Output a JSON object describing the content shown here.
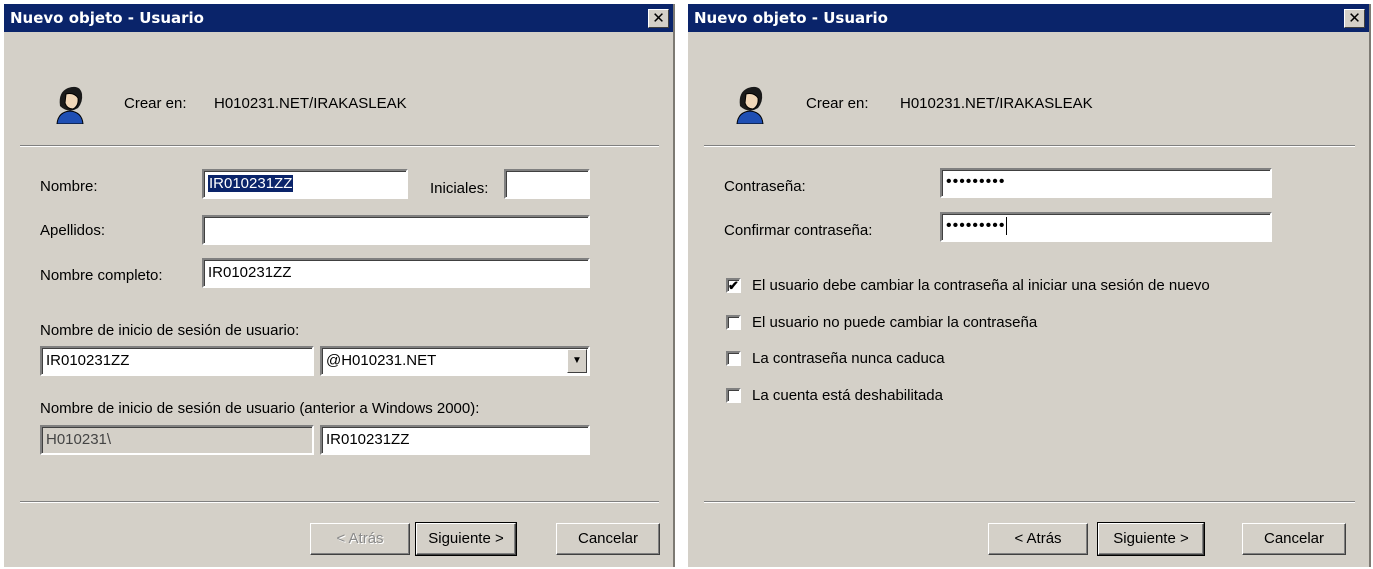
{
  "dialog1": {
    "title": "Nuevo objeto - Usuario",
    "create_in_label": "Crear en:",
    "create_in_path": "H010231.NET/IRAKASLEAK",
    "nombre_label": "Nombre:",
    "nombre_value": "IR010231ZZ",
    "iniciales_label": "Iniciales:",
    "iniciales_value": "",
    "apellidos_label": "Apellidos:",
    "apellidos_value": "",
    "nombre_completo_label": "Nombre completo:",
    "nombre_completo_value": "IR010231ZZ",
    "logon_label": "Nombre de inicio de sesión de usuario:",
    "logon_value": "IR010231ZZ",
    "domain_suffix": "@H010231.NET",
    "prewin_label": "Nombre de inicio de sesión de usuario (anterior a Windows 2000):",
    "prewin_domain": "H010231\\",
    "prewin_user": "IR010231ZZ",
    "back_button": "< Atrás",
    "next_button": "Siguiente >",
    "cancel_button": "Cancelar"
  },
  "dialog2": {
    "title": "Nuevo objeto - Usuario",
    "create_in_label": "Crear en:",
    "create_in_path": "H010231.NET/IRAKASLEAK",
    "password_label": "Contraseña:",
    "password_value": "•••••••••",
    "confirm_label": "Confirmar contraseña:",
    "confirm_value": "•••••••••",
    "checkboxes": [
      {
        "label": "El usuario debe cambiar la contraseña al iniciar una sesión de nuevo",
        "checked": true
      },
      {
        "label": "El usuario no puede cambiar la contraseña",
        "checked": false
      },
      {
        "label": "La contraseña nunca caduca",
        "checked": false
      },
      {
        "label": "La cuenta está deshabilitada",
        "checked": false
      }
    ],
    "check_mark": "✔",
    "back_button": "< Atrás",
    "next_button": "Siguiente >",
    "cancel_button": "Cancelar"
  },
  "close_glyph": "✕",
  "dropdown_glyph": "▼"
}
